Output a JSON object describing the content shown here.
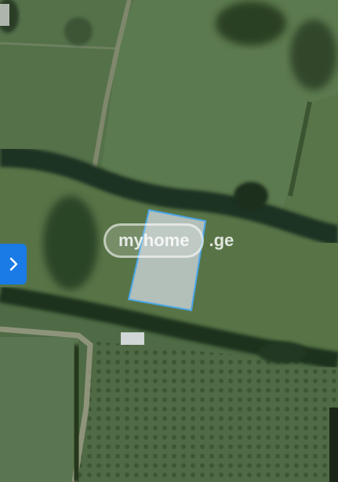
{
  "map": {
    "type": "satellite",
    "overlay": {
      "shape": "polygon",
      "stroke_color": "#4aa6e8",
      "fill_color": "#d7dde6"
    }
  },
  "watermark": {
    "brand": "myhome",
    "suffix": ".ge"
  },
  "controls": {
    "next_icon": "chevron-right-icon",
    "accent_color": "#1a7be6"
  }
}
